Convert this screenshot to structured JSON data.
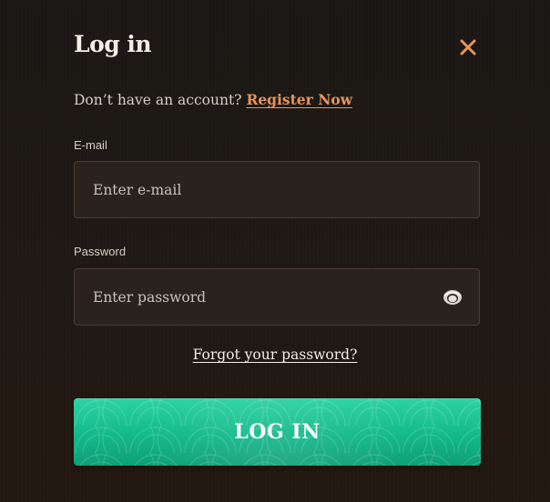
{
  "modal": {
    "title": "Log in",
    "close_icon": "close-icon",
    "register_prompt": "Don’t have an account?",
    "register_link": "Register Now"
  },
  "email": {
    "label": "E-mail",
    "placeholder": "Enter e-mail",
    "value": ""
  },
  "password": {
    "label": "Password",
    "placeholder": "Enter password",
    "value": "",
    "toggle_icon": "eye-icon"
  },
  "forgot_link": "Forgot your password?",
  "login_button": "LOG IN",
  "colors": {
    "background": "#1b1613",
    "accent": "#e8955a",
    "button": "#17bf8f",
    "field_bg": "#2a221d",
    "text": "#f3ede5"
  }
}
